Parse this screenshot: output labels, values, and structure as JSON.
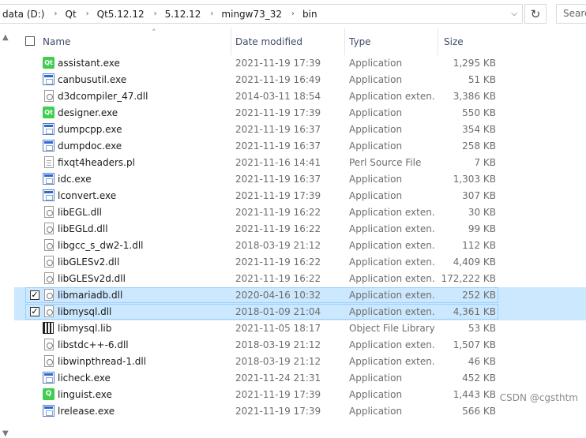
{
  "address": {
    "crumbs": [
      "data (D:)",
      "Qt",
      "Qt5.12.12",
      "5.12.12",
      "mingw73_32",
      "bin"
    ],
    "search_placeholder": "Searc"
  },
  "columns": {
    "name": "Name",
    "date": "Date modified",
    "type": "Type",
    "size": "Size"
  },
  "files": [
    {
      "icon": "qt-app-icon",
      "name": "assistant.exe",
      "date": "2021-11-19 17:39",
      "type": "Application",
      "size": "1,295 KB",
      "selected": false
    },
    {
      "icon": "app-icon",
      "name": "canbusutil.exe",
      "date": "2021-11-19 16:49",
      "type": "Application",
      "size": "51 KB",
      "selected": false
    },
    {
      "icon": "dll-icon",
      "name": "d3dcompiler_47.dll",
      "date": "2014-03-11 18:54",
      "type": "Application exten...",
      "size": "3,386 KB",
      "selected": false
    },
    {
      "icon": "qt-app-icon",
      "name": "designer.exe",
      "date": "2021-11-19 17:39",
      "type": "Application",
      "size": "550 KB",
      "selected": false
    },
    {
      "icon": "app-icon",
      "name": "dumpcpp.exe",
      "date": "2021-11-19 16:37",
      "type": "Application",
      "size": "354 KB",
      "selected": false
    },
    {
      "icon": "app-icon",
      "name": "dumpdoc.exe",
      "date": "2021-11-19 16:37",
      "type": "Application",
      "size": "258 KB",
      "selected": false
    },
    {
      "icon": "doc-icon",
      "name": "fixqt4headers.pl",
      "date": "2021-11-16 14:41",
      "type": "Perl Source File",
      "size": "7 KB",
      "selected": false
    },
    {
      "icon": "app-icon",
      "name": "idc.exe",
      "date": "2021-11-19 16:37",
      "type": "Application",
      "size": "1,303 KB",
      "selected": false
    },
    {
      "icon": "app-icon",
      "name": "lconvert.exe",
      "date": "2021-11-19 17:39",
      "type": "Application",
      "size": "307 KB",
      "selected": false
    },
    {
      "icon": "dll-icon",
      "name": "libEGL.dll",
      "date": "2021-11-19 16:22",
      "type": "Application exten...",
      "size": "30 KB",
      "selected": false
    },
    {
      "icon": "dll-icon",
      "name": "libEGLd.dll",
      "date": "2021-11-19 16:22",
      "type": "Application exten...",
      "size": "99 KB",
      "selected": false
    },
    {
      "icon": "dll-icon",
      "name": "libgcc_s_dw2-1.dll",
      "date": "2018-03-19 21:12",
      "type": "Application exten...",
      "size": "112 KB",
      "selected": false
    },
    {
      "icon": "dll-icon",
      "name": "libGLESv2.dll",
      "date": "2021-11-19 16:22",
      "type": "Application exten...",
      "size": "4,409 KB",
      "selected": false
    },
    {
      "icon": "dll-icon",
      "name": "libGLESv2d.dll",
      "date": "2021-11-19 16:22",
      "type": "Application exten...",
      "size": "172,222 KB",
      "selected": false
    },
    {
      "icon": "dll-icon",
      "name": "libmariadb.dll",
      "date": "2020-04-16 10:32",
      "type": "Application exten...",
      "size": "252 KB",
      "selected": true
    },
    {
      "icon": "dll-icon",
      "name": "libmysql.dll",
      "date": "2018-01-09 21:04",
      "type": "Application exten...",
      "size": "4,361 KB",
      "selected": true
    },
    {
      "icon": "lib-icon",
      "name": "libmysql.lib",
      "date": "2021-11-05 18:17",
      "type": "Object File Library",
      "size": "53 KB",
      "selected": false
    },
    {
      "icon": "dll-icon",
      "name": "libstdc++-6.dll",
      "date": "2018-03-19 21:12",
      "type": "Application exten...",
      "size": "1,507 KB",
      "selected": false
    },
    {
      "icon": "dll-icon",
      "name": "libwinpthread-1.dll",
      "date": "2018-03-19 21:12",
      "type": "Application exten...",
      "size": "46 KB",
      "selected": false
    },
    {
      "icon": "app-icon",
      "name": "licheck.exe",
      "date": "2021-11-24 21:31",
      "type": "Application",
      "size": "452 KB",
      "selected": false
    },
    {
      "icon": "qt-linguist-icon",
      "name": "linguist.exe",
      "date": "2021-11-19 17:39",
      "type": "Application",
      "size": "1,443 KB",
      "selected": false
    },
    {
      "icon": "app-icon",
      "name": "lrelease.exe",
      "date": "2021-11-19 17:39",
      "type": "Application",
      "size": "566 KB",
      "selected": false
    }
  ],
  "watermark": "CSDN @cgsthtm"
}
